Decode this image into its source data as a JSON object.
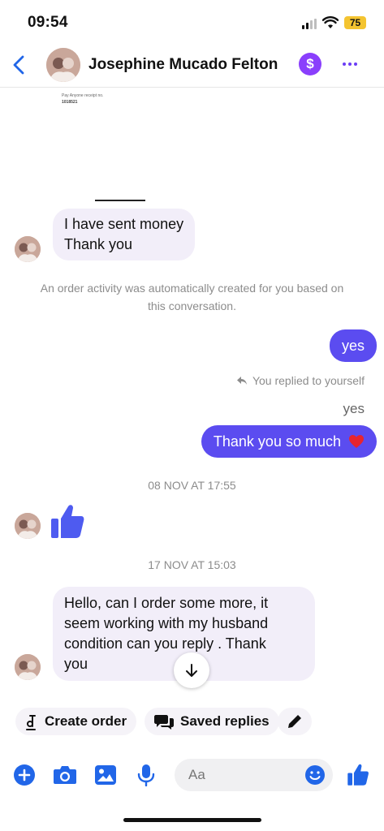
{
  "status_bar": {
    "time": "09:54",
    "battery": "75"
  },
  "header": {
    "contact_name": "Josephine Mucado Felton",
    "pay_symbol": "$"
  },
  "receipt": {
    "line1": "Pay Anyone receipt no.",
    "line2": "1018521"
  },
  "messages": {
    "incoming_1": [
      "I have sent money",
      "Thank you"
    ],
    "system_notice": [
      "An order activity was automatically created for you based on",
      "this conversation."
    ],
    "outgoing_yes": "yes",
    "reply_note": "You replied to yourself",
    "reply_quote": "yes",
    "outgoing_thanks": "Thank you so much",
    "timestamp_1": "08 NOV AT 17:55",
    "timestamp_2": "17 NOV AT 15:03",
    "incoming_2": [
      "Hello, can I order some more, it",
      "seem working with my husband",
      "condition can you reply  . Thank",
      "you"
    ]
  },
  "quick_actions": {
    "create_order": "Create order",
    "saved_replies": "Saved replies"
  },
  "composer": {
    "placeholder": "Aa"
  },
  "colors": {
    "accent": "#5b4cf0",
    "icon_blue": "#2166e8",
    "pay_purple": "#8a3ffc",
    "incoming_bubble": "#f2eef9"
  },
  "icons": [
    "back-chevron-icon",
    "dollar-icon",
    "more-icon",
    "reply-arrow-icon",
    "thumbs-up-icon",
    "arrow-down-icon",
    "order-icon",
    "chat-bubbles-icon",
    "pencil-icon",
    "plus-icon",
    "camera-icon",
    "image-icon",
    "microphone-icon",
    "emoji-icon"
  ]
}
